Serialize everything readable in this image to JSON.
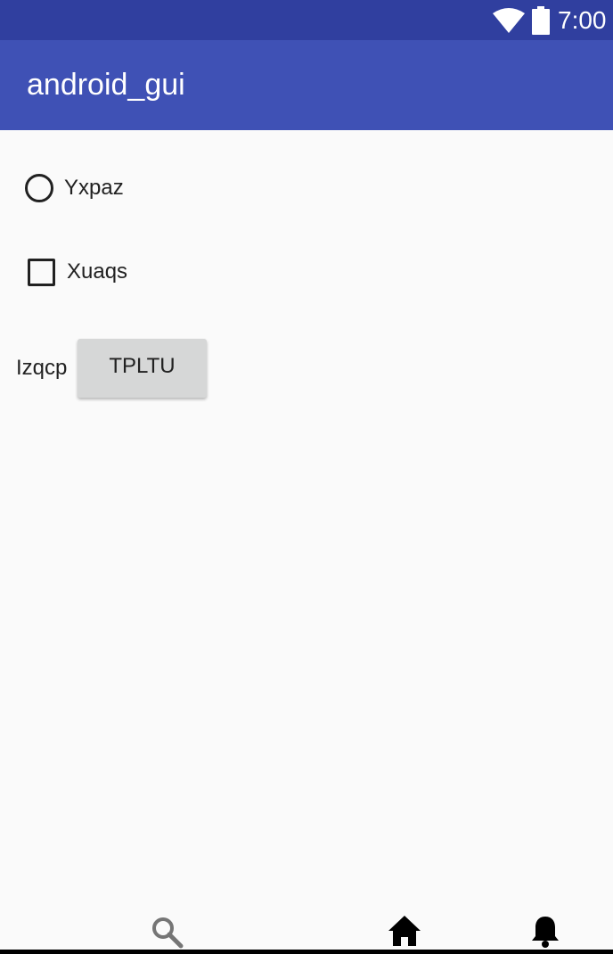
{
  "status_bar": {
    "time": "7:00",
    "icons": [
      "wifi-icon",
      "battery-icon"
    ]
  },
  "app_bar": {
    "title": "android_gui"
  },
  "content": {
    "radio": {
      "label": "Yxpaz",
      "checked": false
    },
    "checkbox": {
      "label": "Xuaqs",
      "checked": false
    },
    "inline_label": "Izqcp",
    "button_label": "TPLTU"
  },
  "bottom_bar": {
    "icons": [
      "search-icon",
      "home-icon",
      "bell-icon"
    ]
  },
  "colors": {
    "status_bar": "#303f9f",
    "app_bar": "#3f51b5",
    "background": "#fafafa",
    "button": "#d6d7d7",
    "text": "#212121"
  }
}
